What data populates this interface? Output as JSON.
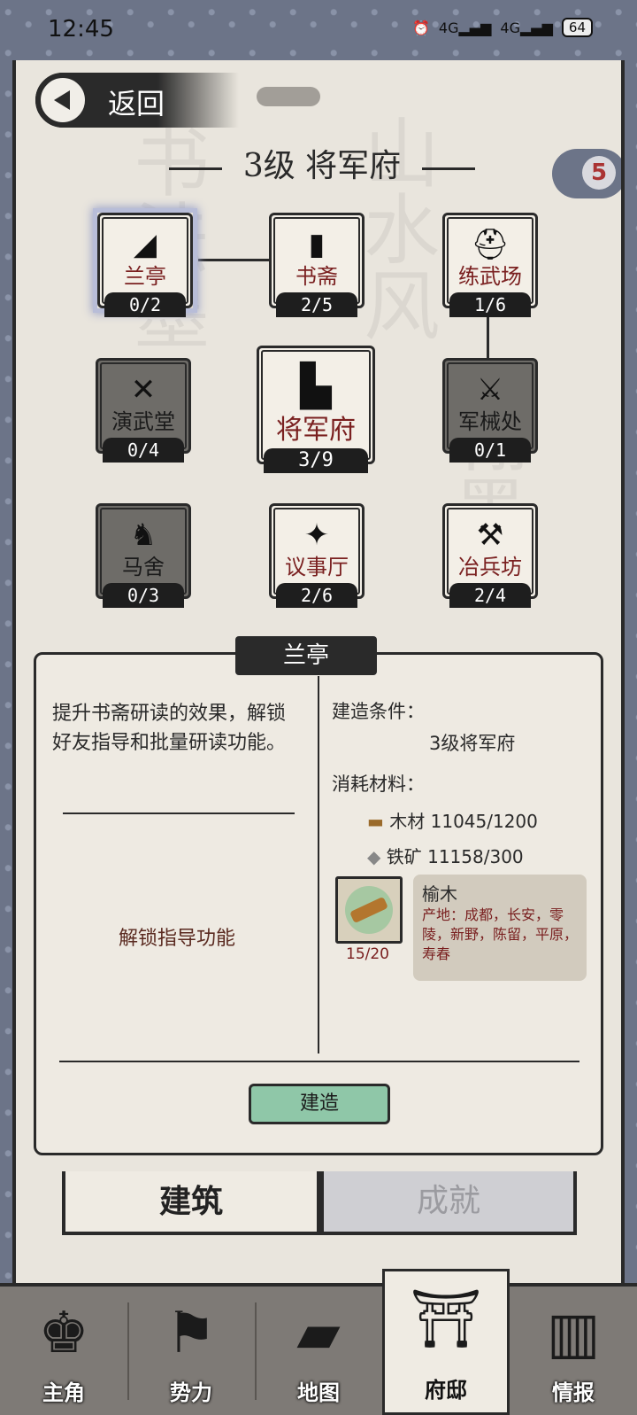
{
  "status": {
    "time": "12:45",
    "net1": "4G",
    "net2": "4G",
    "battery": "64"
  },
  "header": {
    "back_label": "返回",
    "title": "3级 将军府",
    "notif_count": "5"
  },
  "buildings": [
    {
      "name": "兰亭",
      "count": "0/2",
      "icon": "fan-icon",
      "glyph": "◢"
    },
    {
      "name": "书斋",
      "count": "2/5",
      "icon": "book-icon",
      "glyph": "▮"
    },
    {
      "name": "练武场",
      "count": "1/6",
      "icon": "helmet-icon",
      "glyph": "⛑"
    },
    {
      "name": "演武堂",
      "count": "0/4",
      "icon": "crossed-spears-icon",
      "glyph": "✕"
    },
    {
      "name": "将军府",
      "count": "3/9",
      "icon": "mansion-icon",
      "glyph": "▙"
    },
    {
      "name": "军械处",
      "count": "0/1",
      "icon": "swords-icon",
      "glyph": "⚔"
    },
    {
      "name": "马舍",
      "count": "0/3",
      "icon": "horse-icon",
      "glyph": "♞"
    },
    {
      "name": "议事厅",
      "count": "2/6",
      "icon": "official-icon",
      "glyph": "✦"
    },
    {
      "name": "冶兵坊",
      "count": "2/4",
      "icon": "glaive-icon",
      "glyph": "⚒"
    }
  ],
  "panel": {
    "tab_title": "兰亭",
    "description": "提升书斋研读的效果，解锁好友指导和批量研读功能。",
    "unlock": "解锁指导功能",
    "build_condition_label": "建造条件：",
    "build_condition": "3级将军府",
    "materials_label": "消耗材料：",
    "materials": [
      {
        "name": "木材",
        "amount": "11045/1200",
        "icon": "log-icon"
      },
      {
        "name": "铁矿",
        "amount": "11158/300",
        "icon": "ore-icon"
      }
    ],
    "item": {
      "name": "榆木",
      "count": "15/20",
      "origin_label": "产地：",
      "origins": "成都，长安，零陵，新野，陈留，平原，寿春"
    },
    "build_button": "建造"
  },
  "tabs": {
    "active": "建筑",
    "inactive": "成就"
  },
  "nav": [
    {
      "label": "主角",
      "icon": "hero-icon",
      "glyph": "♚"
    },
    {
      "label": "势力",
      "icon": "flag-icon",
      "glyph": "⚑"
    },
    {
      "label": "地图",
      "icon": "map-icon",
      "glyph": "▰"
    },
    {
      "label": "府邸",
      "icon": "mansion-gate-icon",
      "glyph": "⛩"
    },
    {
      "label": "情报",
      "icon": "scroll-icon",
      "glyph": "▥"
    }
  ],
  "colors": {
    "accent_green": "#8fc7a8",
    "frame": "#6c7488",
    "paper": "#e9e5dd",
    "name_red": "#7a2020"
  }
}
